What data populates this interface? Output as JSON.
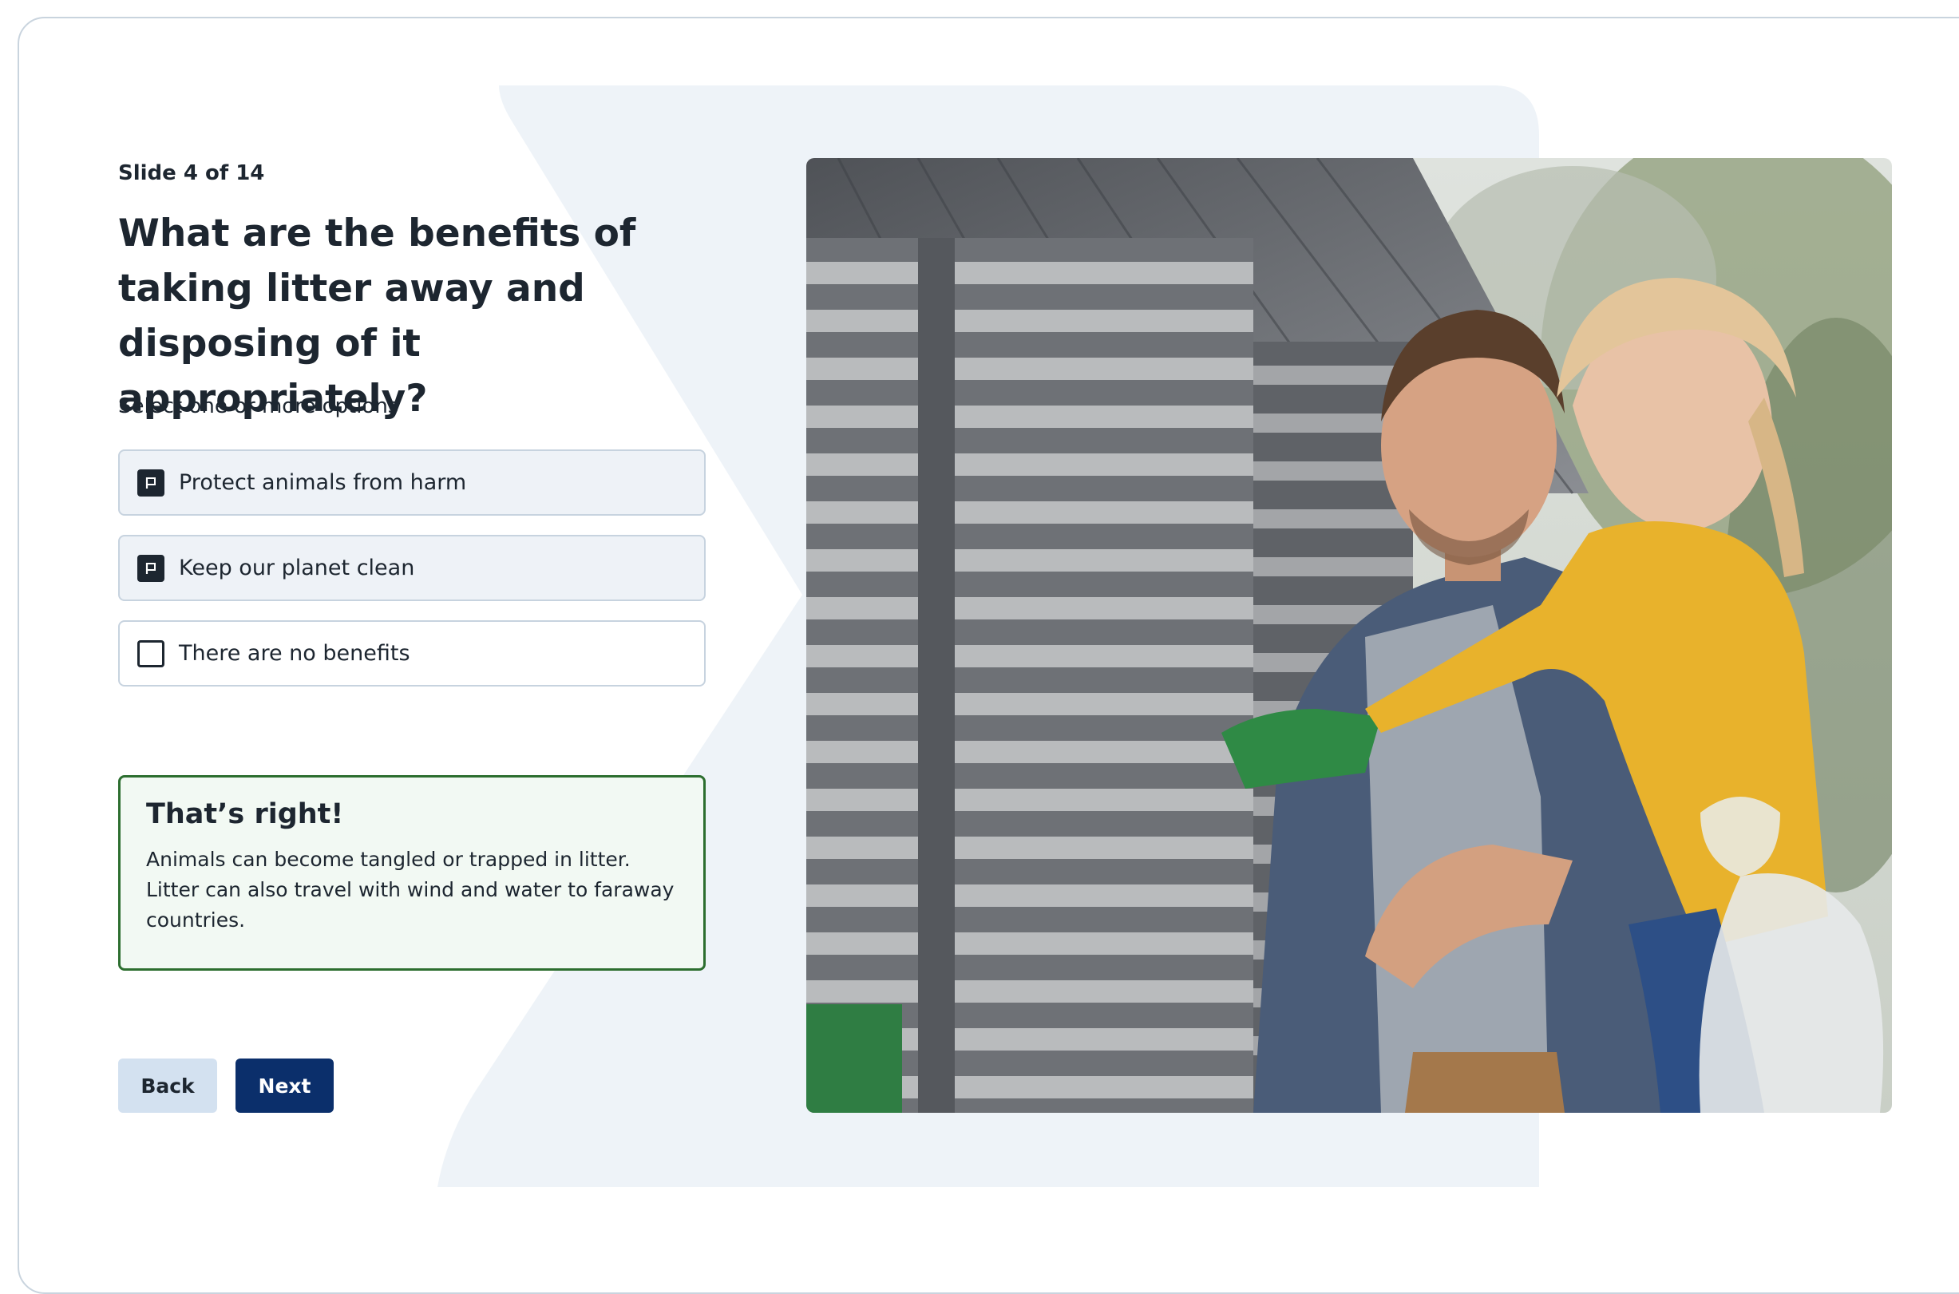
{
  "slide": {
    "counter": "Slide 4 of 14",
    "question": "What are the benefits of taking litter away and disposing of it appropriately?",
    "instruction": "Select one or more options"
  },
  "options": [
    {
      "label": "Protect animals from harm",
      "selected": true
    },
    {
      "label": "Keep our planet clean",
      "selected": true
    },
    {
      "label": "There are no benefits",
      "selected": false
    }
  ],
  "feedback": {
    "title": "That’s right!",
    "body": "Animals can become tangled or trapped in litter. Litter can also travel with wind and water to faraway countries."
  },
  "navigation": {
    "back_label": "Back",
    "next_label": "Next"
  },
  "colors": {
    "primary": "#0b2f6b",
    "secondary": "#d3e1f0",
    "success_border": "#2c6e2f",
    "success_bg": "#f2f9f3",
    "text": "#1d2630"
  },
  "icons": {
    "selected_checkbox": "flag-checkbox-icon",
    "unselected_checkbox": "empty-checkbox-icon"
  }
}
